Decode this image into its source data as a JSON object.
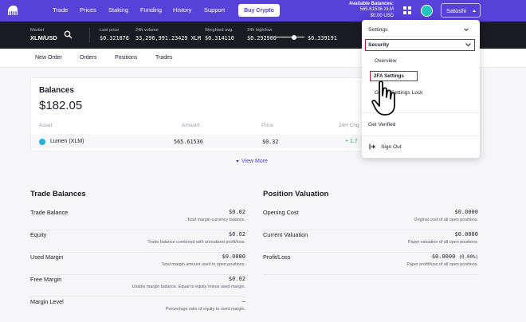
{
  "nav": {
    "items": [
      "Trade",
      "Prices",
      "Staking",
      "Funding",
      "History",
      "Support"
    ],
    "buy_label": "Buy Crypto",
    "available_title": "Available Balances:",
    "available_xlm": "565.61536 XLM",
    "available_usd": "$0.00 USD",
    "user_name": "Satoshi",
    "colors": {
      "brand": "#5741d9",
      "avatar": "#21c5c0"
    }
  },
  "ticker": {
    "market_label": "Market",
    "pair": "XLM/USD",
    "last_price_label": "Last price",
    "last_price": "$0.321878",
    "volume_label": "24h volume",
    "volume": "33,296,991.23429 XLM",
    "wavg_label": "Weighted avg.",
    "wavg": "$0.314110",
    "hl_label": "24h high/low",
    "low": "$0.292900",
    "high": "$0.339191"
  },
  "subtabs": [
    "New Order",
    "Orders",
    "Positions",
    "Trades"
  ],
  "balances": {
    "title": "Balances",
    "total": "$182.05",
    "headers": {
      "asset": "Asset",
      "amount": "Amount",
      "price": "Price",
      "change": "24H Chg"
    },
    "row": {
      "asset": "Lumen (XLM)",
      "amount": "565.61536",
      "price": "$0.32",
      "change": "+ 1.7"
    },
    "view_more": "View More"
  },
  "trade_balances": {
    "title": "Trade Balances",
    "rows": [
      {
        "label": "Trade Balance",
        "value": "$0.02",
        "desc": "Total margin currency balance."
      },
      {
        "label": "Equity",
        "value": "$0.02",
        "desc": "Trade balance combined with unrealized profit/loss."
      },
      {
        "label": "Used Margin",
        "value": "$0.0000",
        "desc": "Total margin amount used in open positions."
      },
      {
        "label": "Free Margin",
        "value": "$0.02",
        "desc": "Usable margin balance. Equal to equity minus used margin."
      },
      {
        "label": "Margin Level",
        "value": "—",
        "desc": "Percentage ratio of equity to used margin."
      }
    ]
  },
  "position_valuation": {
    "title": "Position Valuation",
    "rows": [
      {
        "label": "Opening Cost",
        "value": "$0.0000",
        "pct": "",
        "desc": "Original cost of all open positions."
      },
      {
        "label": "Current Valuation",
        "value": "$0.0000",
        "pct": "",
        "desc": "Paper valuation of all open positions."
      },
      {
        "label": "Profit/Loss",
        "value": "$0.0000",
        "pct": "(0.00%)",
        "desc": "Paper profit/loss of all open positions."
      }
    ]
  },
  "dropdown": {
    "settings": "Settings",
    "security": "Security",
    "overview": "Overview",
    "twofa": "2FA Settings",
    "global_lock": "Global Settings Lock",
    "get_verified": "Get Verified",
    "sign_out": "Sign Out",
    "highlight_color": "#d9122b"
  }
}
